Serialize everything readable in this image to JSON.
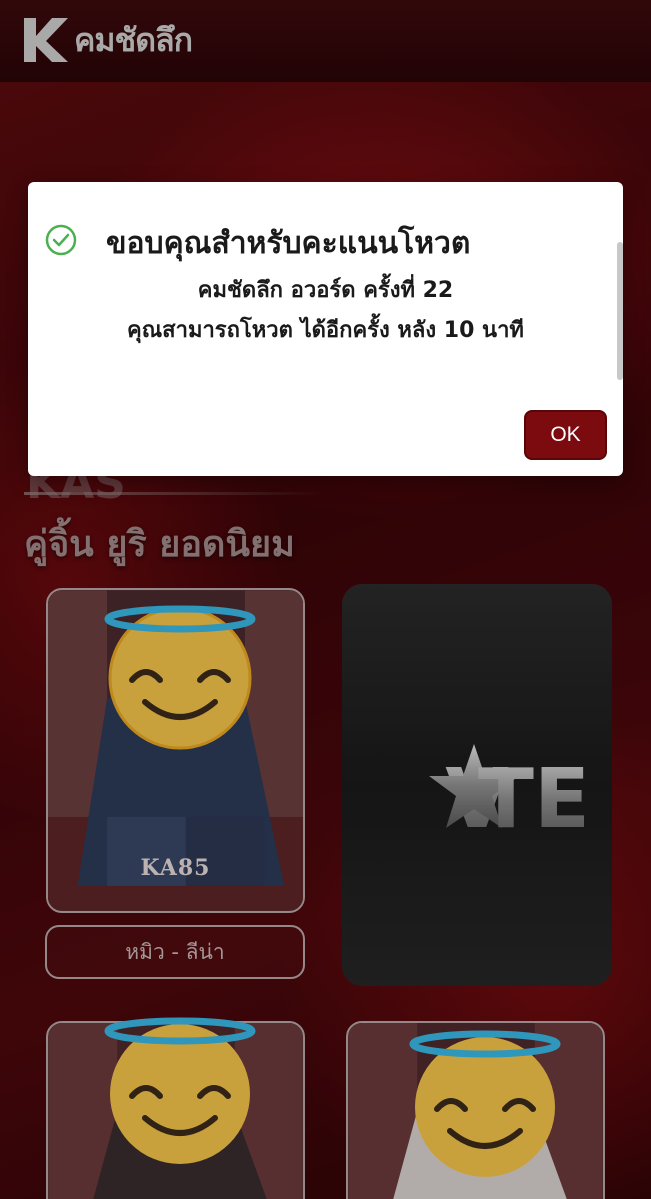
{
  "header": {
    "logo_mark": "K",
    "logo_text": "คมชัดลึก"
  },
  "section": {
    "faded_title": "KAS",
    "category_title": "คู่จิ้น ยูริ ยอดนิยม"
  },
  "cards": [
    {
      "code": "KA85",
      "name": "หมิว - ลีน่า"
    }
  ],
  "vote_card": {
    "label": "VOTE"
  },
  "dialog": {
    "title": "ขอบคุณสำหรับคะแนนโหวต",
    "line1": "คมชัดลึก อวอร์ด ครั้งที่ 22",
    "line2": "คุณสามารถโหวต ได้อีกครั้ง หลัง 10 นาที",
    "ok_label": "OK",
    "icon": "check-circle-icon"
  },
  "colors": {
    "accent": "#7b0b0f",
    "background": "#3a0508",
    "success": "#4caf50"
  }
}
